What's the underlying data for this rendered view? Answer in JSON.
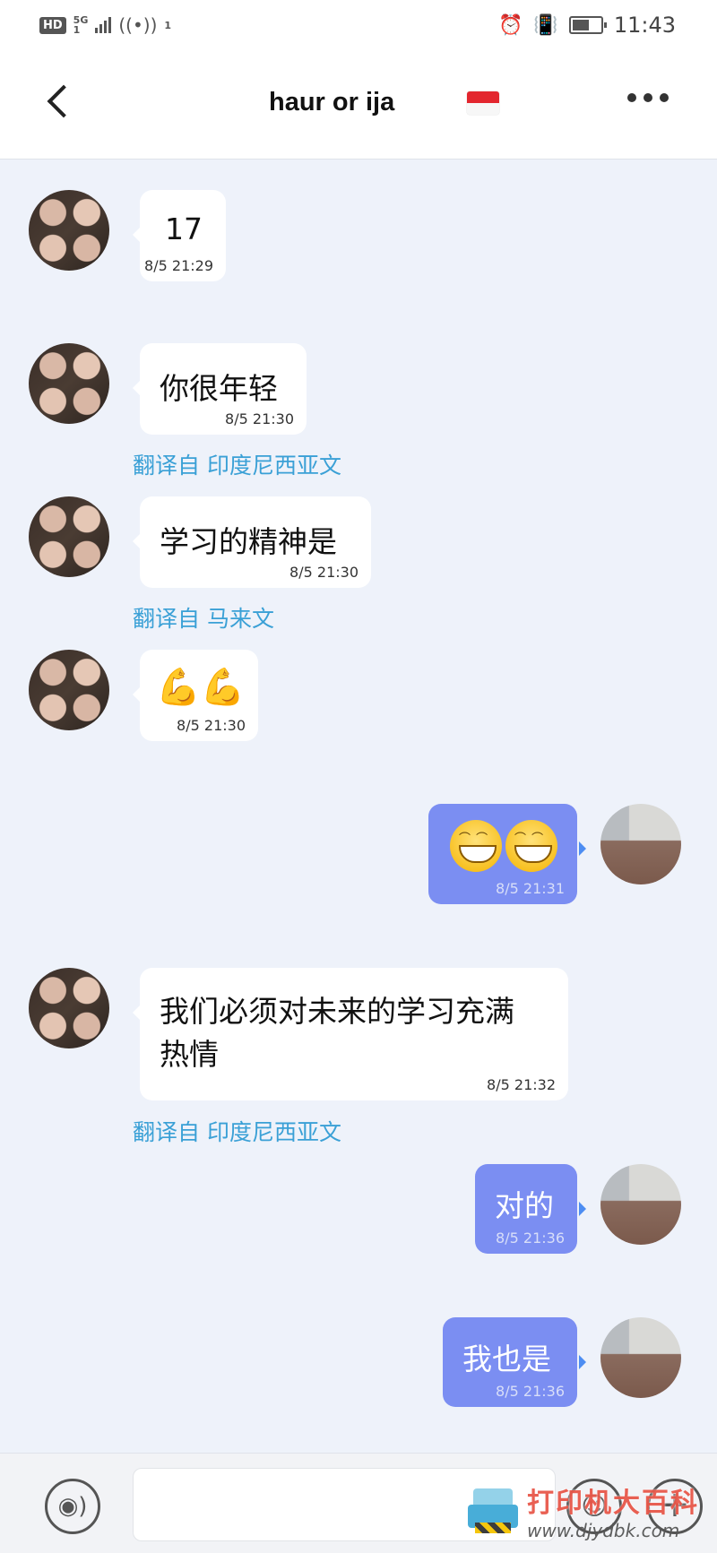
{
  "status_bar": {
    "hd": "HD",
    "network": "5G",
    "network_sub": "1",
    "hotspot_count": "1",
    "time": "11:43",
    "battery_level": 0.6
  },
  "header": {
    "title": "haur or ija",
    "flag": "indonesia-flag-icon"
  },
  "messages": [
    {
      "sender": "them",
      "text": "17",
      "time": "8/5 21:29"
    },
    {
      "sender": "them",
      "text": "你很年轻",
      "time": "8/5 21:30",
      "translated": "翻译自 印度尼西亚文"
    },
    {
      "sender": "them",
      "text": "学习的精神是",
      "time": "8/5 21:30",
      "translated": "翻译自 马来文"
    },
    {
      "sender": "them",
      "emoji": "flexed-biceps-icon",
      "emoji_text": "💪💪",
      "time": "8/5 21:30"
    },
    {
      "sender": "me",
      "emoji": "grinning-face-icon",
      "time": "8/5 21:31"
    },
    {
      "sender": "them",
      "text_line1": "我们必须对未来的学习充满",
      "text_line2": "热情",
      "time": "8/5 21:32",
      "translated": "翻译自 印度尼西亚文"
    },
    {
      "sender": "me",
      "text": "对的",
      "time": "8/5 21:36"
    },
    {
      "sender": "me",
      "text": "我也是",
      "time": "8/5 21:36"
    }
  ],
  "input_bar": {
    "text": "",
    "voice_icon": "voice-icon",
    "emoji_icon": "emoji-icon",
    "plus_icon": "plus-icon"
  },
  "watermark": {
    "title": "打印机大百科",
    "url": "www.djydbk.com"
  },
  "colors": {
    "background": "#eef2fa",
    "my_bubble": "#7b8ef2",
    "translation_link": "#3aa0d6"
  }
}
